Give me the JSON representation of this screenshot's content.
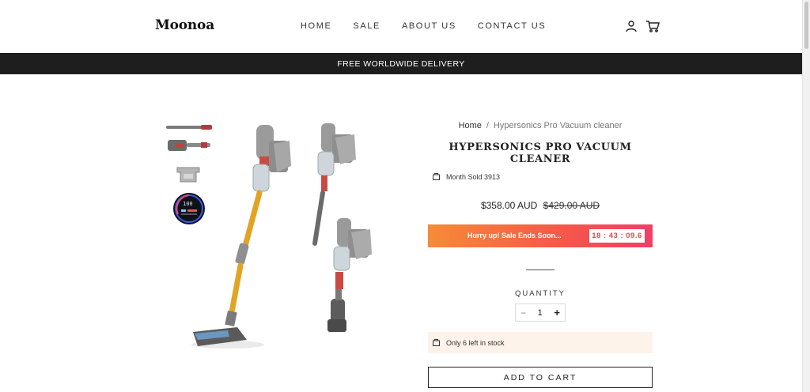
{
  "brand": "Moonoa",
  "nav": [
    "HOME",
    "SALE",
    "ABOUT US",
    "CONTACT US"
  ],
  "icons": {
    "account": "user-icon",
    "cart": "cart-icon",
    "sold": "bag-icon",
    "stock": "bag-icon"
  },
  "announcement": "FREE WORLDWIDE DELIVERY",
  "breadcrumb": {
    "home": "Home",
    "separator": "/",
    "current": "Hypersonics Pro Vacuum cleaner"
  },
  "product": {
    "title": "HYPERSONICS PRO VACUUM CLEANER",
    "sold": "Month Sold 3913",
    "price": "$358.00 AUD",
    "compare_price": "$429.00 AUD"
  },
  "sale": {
    "text": "Hurry up! Sale Ends Soon...",
    "timer": "18 : 43 : 09.6"
  },
  "quantity": {
    "label": "QUANTITY",
    "value": "1",
    "minus": "−",
    "plus": "+"
  },
  "stock": "Only 6 left in stock",
  "add_to_cart": "ADD TO CART",
  "colors": {
    "announce_bg": "#1e1e1e",
    "sale_start": "#f68b36",
    "sale_end": "#ef3f66",
    "stock_bg": "#fdf3ea",
    "accent_gold": "#e1a324"
  }
}
